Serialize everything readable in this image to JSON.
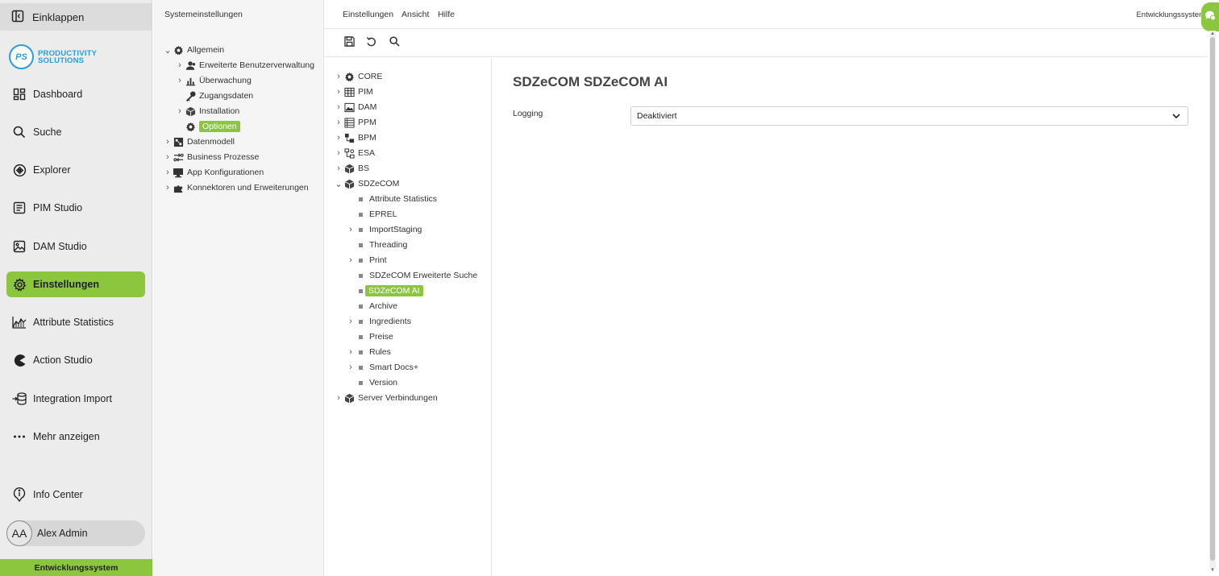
{
  "leftnav": {
    "collapse_label": "Einklappen",
    "logo": {
      "initials": "PS",
      "line1": "PRODUCTIVITY",
      "line2": "SOLUTIONS"
    },
    "items": [
      {
        "label": "Dashboard",
        "icon": "dashboard-icon"
      },
      {
        "label": "Suche",
        "icon": "search-icon"
      },
      {
        "label": "Explorer",
        "icon": "explorer-icon"
      },
      {
        "label": "PIM Studio",
        "icon": "pim-icon"
      },
      {
        "label": "DAM Studio",
        "icon": "image-icon"
      },
      {
        "label": "Einstellungen",
        "icon": "gear-icon",
        "active": true
      },
      {
        "label": "Attribute Statistics",
        "icon": "chart-icon"
      },
      {
        "label": "Action Studio",
        "icon": "pacman-icon"
      },
      {
        "label": "Integration Import",
        "icon": "import-icon"
      },
      {
        "label": "Mehr anzeigen",
        "icon": "more-icon"
      }
    ],
    "info_center": "Info Center",
    "user": {
      "initials": "AA",
      "name": "Alex Admin"
    },
    "environment": "Entwicklungssystem"
  },
  "settings_tree": {
    "heading": "Systemeinstellungen",
    "nodes": [
      {
        "label": "Allgemein",
        "level": 0,
        "expanded": true,
        "icon": "gear-icon"
      },
      {
        "label": "Erweiterte Benutzerverwaltung",
        "level": 1,
        "expandable": true,
        "icon": "users-icon"
      },
      {
        "label": "Überwachung",
        "level": 1,
        "expandable": true,
        "icon": "bar-chart-icon"
      },
      {
        "label": "Zugangsdaten",
        "level": 1,
        "icon": "key-icon"
      },
      {
        "label": "Installation",
        "level": 1,
        "expandable": true,
        "icon": "package-icon"
      },
      {
        "label": "Optionen",
        "level": 1,
        "selected": true,
        "icon": "gear-icon"
      },
      {
        "label": "Datenmodell",
        "level": 0,
        "expandable": true,
        "icon": "datamodel-icon"
      },
      {
        "label": "Business Prozesse",
        "level": 0,
        "expandable": true,
        "icon": "process-icon"
      },
      {
        "label": "App Konfigurationen",
        "level": 0,
        "expandable": true,
        "icon": "monitor-icon"
      },
      {
        "label": "Konnektoren und Erweiterungen",
        "level": 0,
        "expandable": true,
        "icon": "puzzle-icon"
      }
    ]
  },
  "topbar": {
    "menus": [
      "Einstellungen",
      "Ansicht",
      "Hilfe"
    ],
    "environment_label": "Entwicklungssystem"
  },
  "toolbar": {
    "tools": [
      "save-icon",
      "undo-icon",
      "search-icon"
    ]
  },
  "options_tree": [
    {
      "label": "CORE",
      "icon": "gear-icon",
      "expandable": true
    },
    {
      "label": "PIM",
      "icon": "table-icon",
      "expandable": true
    },
    {
      "label": "DAM",
      "icon": "image-icon",
      "expandable": true
    },
    {
      "label": "PPM",
      "icon": "grid-icon",
      "expandable": true
    },
    {
      "label": "BPM",
      "icon": "bpm-icon",
      "expandable": true
    },
    {
      "label": "ESA",
      "icon": "esa-icon",
      "expandable": true
    },
    {
      "label": "BS",
      "icon": "package-icon",
      "expandable": true
    },
    {
      "label": "SDZeCOM",
      "icon": "package-icon",
      "expanded": true,
      "children": [
        {
          "label": "Attribute Statistics"
        },
        {
          "label": "EPREL"
        },
        {
          "label": "ImportStaging",
          "expandable": true
        },
        {
          "label": "Threading"
        },
        {
          "label": "Print",
          "expandable": true
        },
        {
          "label": "SDZeCOM Erweiterte Suche"
        },
        {
          "label": "SDZeCOM AI",
          "selected": true
        },
        {
          "label": "Archive"
        },
        {
          "label": "Ingredients",
          "expandable": true
        },
        {
          "label": "Preise"
        },
        {
          "label": "Rules",
          "expandable": true
        },
        {
          "label": "Smart Docs+",
          "expandable": true
        },
        {
          "label": "Version"
        }
      ]
    },
    {
      "label": "Server Verbindungen",
      "icon": "package-icon",
      "expandable": true
    }
  ],
  "detail": {
    "title": "SDZeCOM SDZeCOM AI",
    "fields": [
      {
        "label": "Logging",
        "value": "Deaktiviert"
      }
    ]
  },
  "colors": {
    "accent": "#8cc63f",
    "brand": "#2a9fd8"
  }
}
